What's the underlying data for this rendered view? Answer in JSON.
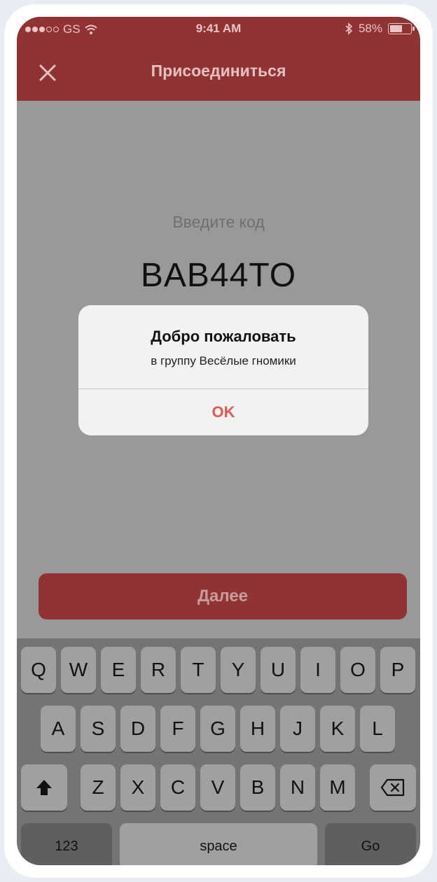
{
  "status_bar": {
    "carrier": "GS",
    "time": "9:41 AM",
    "battery": "58%",
    "battery_level": 0.58
  },
  "nav": {
    "title": "Присоединиться",
    "close_icon": "close-icon"
  },
  "form": {
    "prompt": "Введите код",
    "code": "BAB44TO"
  },
  "alert": {
    "title": "Добро пожаловать",
    "message": "в группу Весёлые гномики",
    "button": "OK"
  },
  "next_button": "Далее",
  "keyboard": {
    "row1": [
      "Q",
      "W",
      "E",
      "R",
      "T",
      "Y",
      "U",
      "I",
      "O",
      "P"
    ],
    "row2": [
      "A",
      "S",
      "D",
      "F",
      "G",
      "H",
      "J",
      "K",
      "L"
    ],
    "row3": [
      "Z",
      "X",
      "C",
      "V",
      "B",
      "N",
      "M"
    ],
    "numbers": "123",
    "space": "space",
    "go": "Go",
    "shift_icon": "shift-icon",
    "backspace_icon": "backspace-icon"
  },
  "colors": {
    "accent": "#8f3334",
    "alert_button": "#e05a55"
  }
}
